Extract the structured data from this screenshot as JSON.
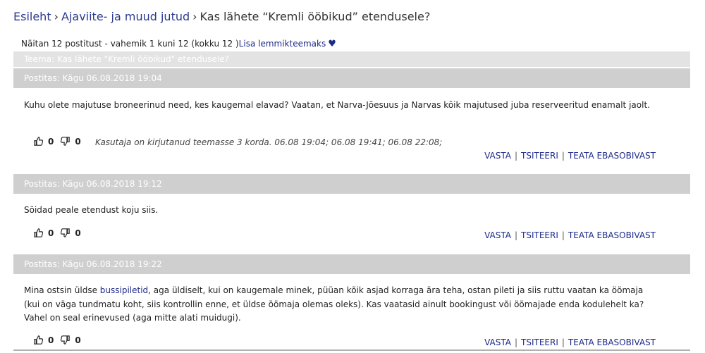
{
  "breadcrumb": {
    "home": "Esileht",
    "category": "Ajaviite- ja muud jutud",
    "current": "Kas lähete “Kremli ööbikud” etendusele?",
    "separator": "›"
  },
  "summary": {
    "text": "Näitan 12 postitust - vahemik 1 kuni 12 (kokku 12 )",
    "favorite_link": "Lisa lemmikteemaks",
    "heart": "♥"
  },
  "topic_bar": "Teema: Kas lähete \"Kremli ööbikud\" etendusele?",
  "actions": {
    "reply": "VASTA",
    "quote": "TSITEERI",
    "report": "TEATA EBASOBIVAST",
    "separator": "|"
  },
  "posts": [
    {
      "header": "Postitas: Kägu 06.08.2018 19:04",
      "text": "Kuhu olete majutuse broneerinud need, kes kaugemal elavad? Vaatan, et Narva-Jõesuus ja Narvas kõik majutused juba reserveeritud enamalt jaolt.",
      "likes": "0",
      "dislikes": "0",
      "note": "Kasutaja on kirjutanud teemasse 3 korda. 06.08 19:04; 06.08 19:41; 06.08 22:08;"
    },
    {
      "header": "Postitas: Kägu 06.08.2018 19:12",
      "text": "Sõidad peale etendust koju siis.",
      "likes": "0",
      "dislikes": "0"
    },
    {
      "header": "Postitas: Kägu 06.08.2018 19:22",
      "text_before": "Mina ostsin üldse ",
      "link": "bussipiletid",
      "text_after": ", aga üldiselt, kui on kaugemale minek, püüan kõik asjad korraga ära teha, ostan pileti ja siis ruttu vaatan ka öömaja (kui on väga tundmatu koht, siis kontrollin enne, et üldse öömaja olemas oleks). Kas vaatasid ainult bookingust või öömajade enda kodulehelt ka? Vahel on seal erinevused (aga mitte alati muidugi).",
      "likes": "0",
      "dislikes": "0"
    }
  ]
}
